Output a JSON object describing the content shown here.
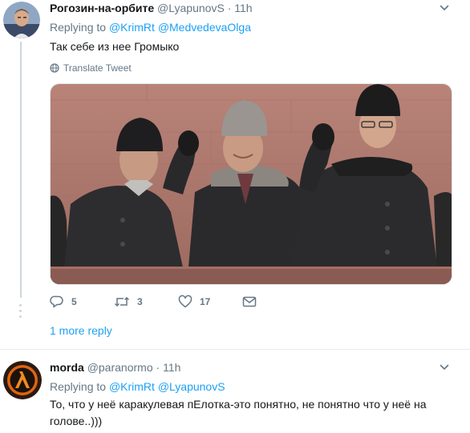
{
  "tweet1": {
    "name": "Рогозин-на-орбите",
    "handle": "@LyapunovS",
    "separator": "·",
    "time": "11h",
    "replying_prefix": "Replying to",
    "reply_to": [
      "@KrimRt",
      "@MedvedevaOlga"
    ],
    "text": "Так себе из нее Громыко",
    "translate_label": "Translate Tweet",
    "actions": {
      "reply_count": "5",
      "retweet_count": "3",
      "like_count": "17"
    },
    "more_reply": "1 more reply"
  },
  "tweet2": {
    "name": "morda",
    "handle": "@paranormo",
    "separator": "·",
    "time": "11h",
    "replying_prefix": "Replying to",
    "reply_to": [
      "@KrimRt",
      "@LyapunovS"
    ],
    "text": "То, что у неё каракулевая пЕлотка-это понятно, не понятно что у неё на голове..)))"
  },
  "colors": {
    "link": "#1da1f2",
    "secondary": "#657786",
    "primary_text": "#14171a",
    "divider": "#e6ecf0"
  },
  "icons": [
    "caret-down-icon",
    "globe-icon",
    "reply-icon",
    "retweet-icon",
    "heart-icon",
    "message-icon"
  ]
}
